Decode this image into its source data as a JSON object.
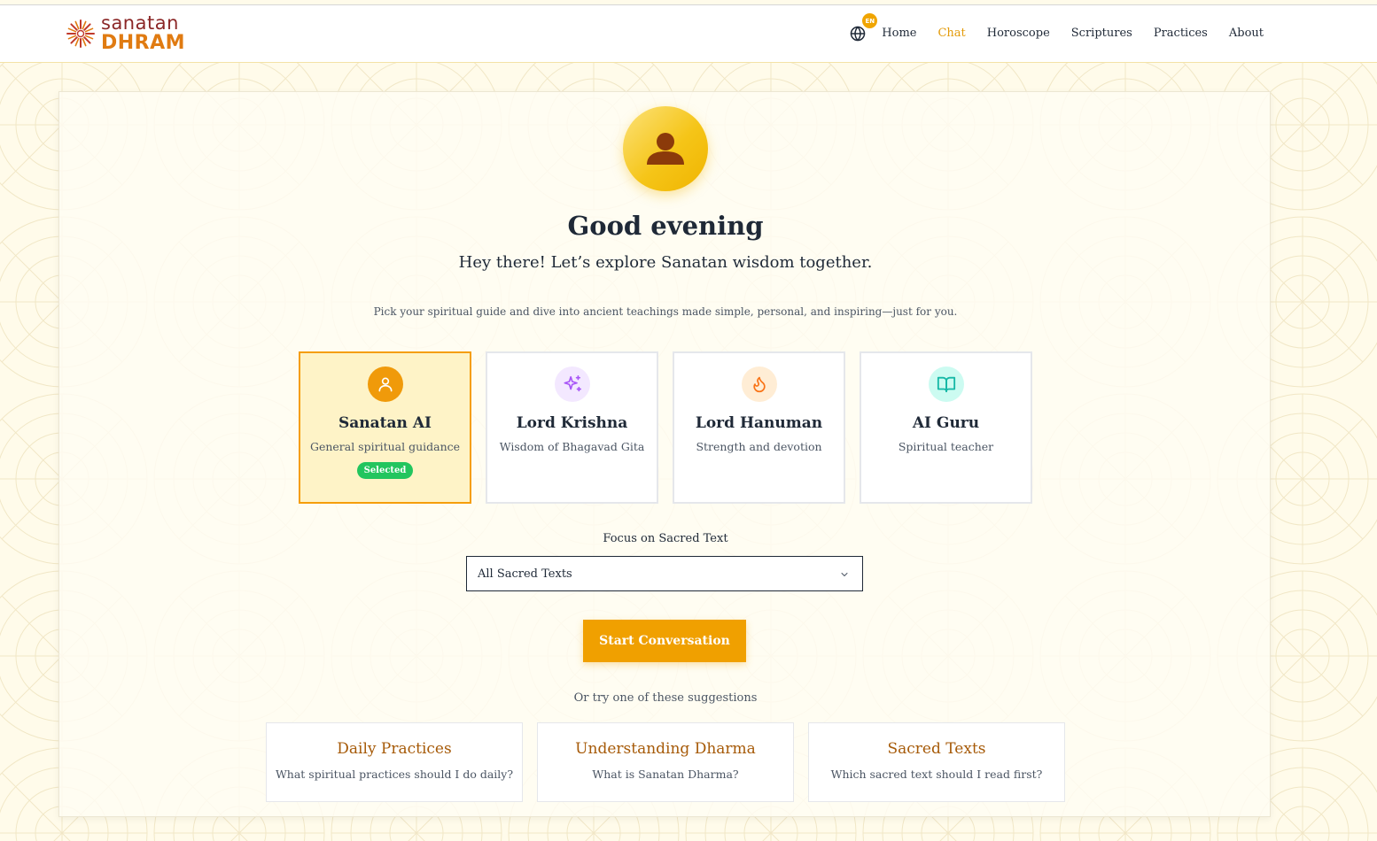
{
  "brand": {
    "logo_line1": "sanatan",
    "logo_line2": "DHRAM"
  },
  "nav": {
    "language_badge": "EN",
    "items": [
      {
        "label": "Home",
        "active": false
      },
      {
        "label": "Chat",
        "active": true
      },
      {
        "label": "Horoscope",
        "active": false
      },
      {
        "label": "Scriptures",
        "active": false
      },
      {
        "label": "Practices",
        "active": false
      },
      {
        "label": "About",
        "active": false
      }
    ]
  },
  "hero": {
    "avatar_icon": "user-icon",
    "greeting": "Good evening",
    "subtitle": "Hey there! Let’s explore Sanatan wisdom together.",
    "description": "Pick your spiritual guide and dive into ancient teachings made simple, personal, and inspiring—just for you."
  },
  "guides": [
    {
      "name": "Sanatan AI",
      "subtitle": "General spiritual guidance",
      "icon": "user-icon",
      "selected": true,
      "badge": "Selected"
    },
    {
      "name": "Lord Krishna",
      "subtitle": "Wisdom of Bhagavad Gita",
      "icon": "sparkles-icon",
      "selected": false
    },
    {
      "name": "Lord Hanuman",
      "subtitle": "Strength and devotion",
      "icon": "flame-icon",
      "selected": false
    },
    {
      "name": "AI Guru",
      "subtitle": "Spiritual teacher",
      "icon": "book-open-icon",
      "selected": false
    }
  ],
  "focus": {
    "label": "Focus on Sacred Text",
    "selected": "All Sacred Texts"
  },
  "start_button": "Start Conversation",
  "suggestions_intro": "Or try one of these suggestions",
  "suggestions": [
    {
      "title": "Daily Practices",
      "question": "What spiritual practices should I do daily?"
    },
    {
      "title": "Understanding Dharma",
      "question": "What is Sanatan Dharma?"
    },
    {
      "title": "Sacred Texts",
      "question": "Which sacred text should I read first?"
    }
  ],
  "colors": {
    "accent": "#f0a000",
    "brand_red": "#8b2727",
    "brand_orange": "#e07b12",
    "active_nav": "#e39b0a",
    "selected_badge": "#22c55e"
  }
}
